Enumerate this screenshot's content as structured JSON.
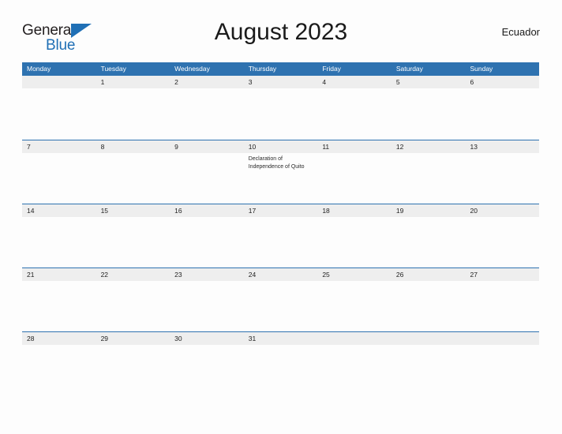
{
  "brand": {
    "name_part1": "General",
    "name_part2": "Blue",
    "triangle_icon": "triangle-right-icon",
    "primary_color": "#1f6fb5"
  },
  "header": {
    "title": "August 2023",
    "country": "Ecuador"
  },
  "theme": {
    "header_blue": "#2e72b0",
    "date_strip_gray": "#eeeeee",
    "page_background": "#fdfdfd",
    "text_color": "#222222"
  },
  "calendar": {
    "weekdays": [
      "Monday",
      "Tuesday",
      "Wednesday",
      "Thursday",
      "Friday",
      "Saturday",
      "Sunday"
    ],
    "weeks": [
      {
        "days": [
          {
            "num": "",
            "event": ""
          },
          {
            "num": "1",
            "event": ""
          },
          {
            "num": "2",
            "event": ""
          },
          {
            "num": "3",
            "event": ""
          },
          {
            "num": "4",
            "event": ""
          },
          {
            "num": "5",
            "event": ""
          },
          {
            "num": "6",
            "event": ""
          }
        ]
      },
      {
        "days": [
          {
            "num": "7",
            "event": ""
          },
          {
            "num": "8",
            "event": ""
          },
          {
            "num": "9",
            "event": ""
          },
          {
            "num": "10",
            "event": "Declaration of Independence of Quito"
          },
          {
            "num": "11",
            "event": ""
          },
          {
            "num": "12",
            "event": ""
          },
          {
            "num": "13",
            "event": ""
          }
        ]
      },
      {
        "days": [
          {
            "num": "14",
            "event": ""
          },
          {
            "num": "15",
            "event": ""
          },
          {
            "num": "16",
            "event": ""
          },
          {
            "num": "17",
            "event": ""
          },
          {
            "num": "18",
            "event": ""
          },
          {
            "num": "19",
            "event": ""
          },
          {
            "num": "20",
            "event": ""
          }
        ]
      },
      {
        "days": [
          {
            "num": "21",
            "event": ""
          },
          {
            "num": "22",
            "event": ""
          },
          {
            "num": "23",
            "event": ""
          },
          {
            "num": "24",
            "event": ""
          },
          {
            "num": "25",
            "event": ""
          },
          {
            "num": "26",
            "event": ""
          },
          {
            "num": "27",
            "event": ""
          }
        ]
      },
      {
        "days": [
          {
            "num": "28",
            "event": ""
          },
          {
            "num": "29",
            "event": ""
          },
          {
            "num": "30",
            "event": ""
          },
          {
            "num": "31",
            "event": ""
          },
          {
            "num": "",
            "event": ""
          },
          {
            "num": "",
            "event": ""
          },
          {
            "num": "",
            "event": ""
          }
        ]
      }
    ]
  }
}
